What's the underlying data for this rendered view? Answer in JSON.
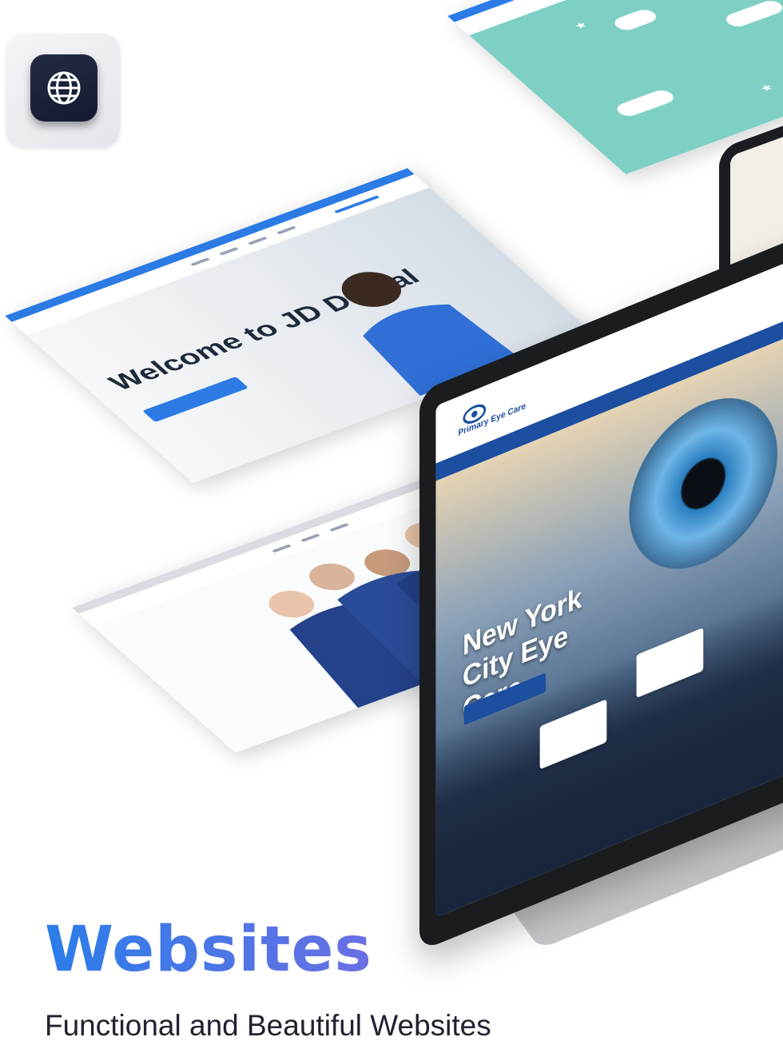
{
  "icon": {
    "name": "globe-icon"
  },
  "headline": "Websites",
  "subheadline": "Functional and Beautiful Websites",
  "mockups": {
    "dental": {
      "title": "Welcome to JD Dental"
    },
    "eye": {
      "brand": "Primary Eye Care",
      "title": "New York City Eye Care"
    }
  },
  "colors": {
    "accent_start": "#2b7de9",
    "accent_end": "#6a6fe3",
    "icon_bg": "#1a2038"
  }
}
